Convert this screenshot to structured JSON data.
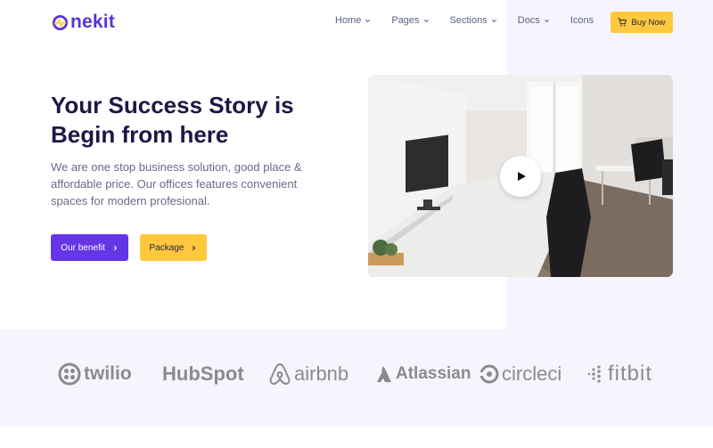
{
  "header": {
    "logo_text": "nekit",
    "nav": [
      {
        "label": "Home",
        "has_dropdown": true
      },
      {
        "label": "Pages",
        "has_dropdown": true
      },
      {
        "label": "Sections",
        "has_dropdown": true
      },
      {
        "label": "Docs",
        "has_dropdown": true
      },
      {
        "label": "Icons",
        "has_dropdown": false
      }
    ],
    "buy_button": {
      "label": "Buy Now",
      "icon": "cart-icon"
    }
  },
  "hero": {
    "title": "Your Success Story is Begin from here",
    "description": "We are one stop business solution, good place & affordable price. Our offices features convenient spaces for modern profesional.",
    "primary_button": {
      "label": "Our benefit",
      "icon": "chevron-right-icon"
    },
    "secondary_button": {
      "label": "Package",
      "icon": "chevron-right-icon"
    },
    "video": {
      "play_icon": "play-icon"
    }
  },
  "brands": [
    {
      "name": "twilio"
    },
    {
      "name": "HubSpot"
    },
    {
      "name": "airbnb"
    },
    {
      "name": "Atlassian"
    },
    {
      "name": "circleci"
    },
    {
      "name": "fitbit"
    }
  ],
  "colors": {
    "brand_purple": "#6436e6",
    "accent_yellow": "#ffc83e",
    "heading": "#1e1746",
    "panel_bg": "#f6f5fd"
  }
}
